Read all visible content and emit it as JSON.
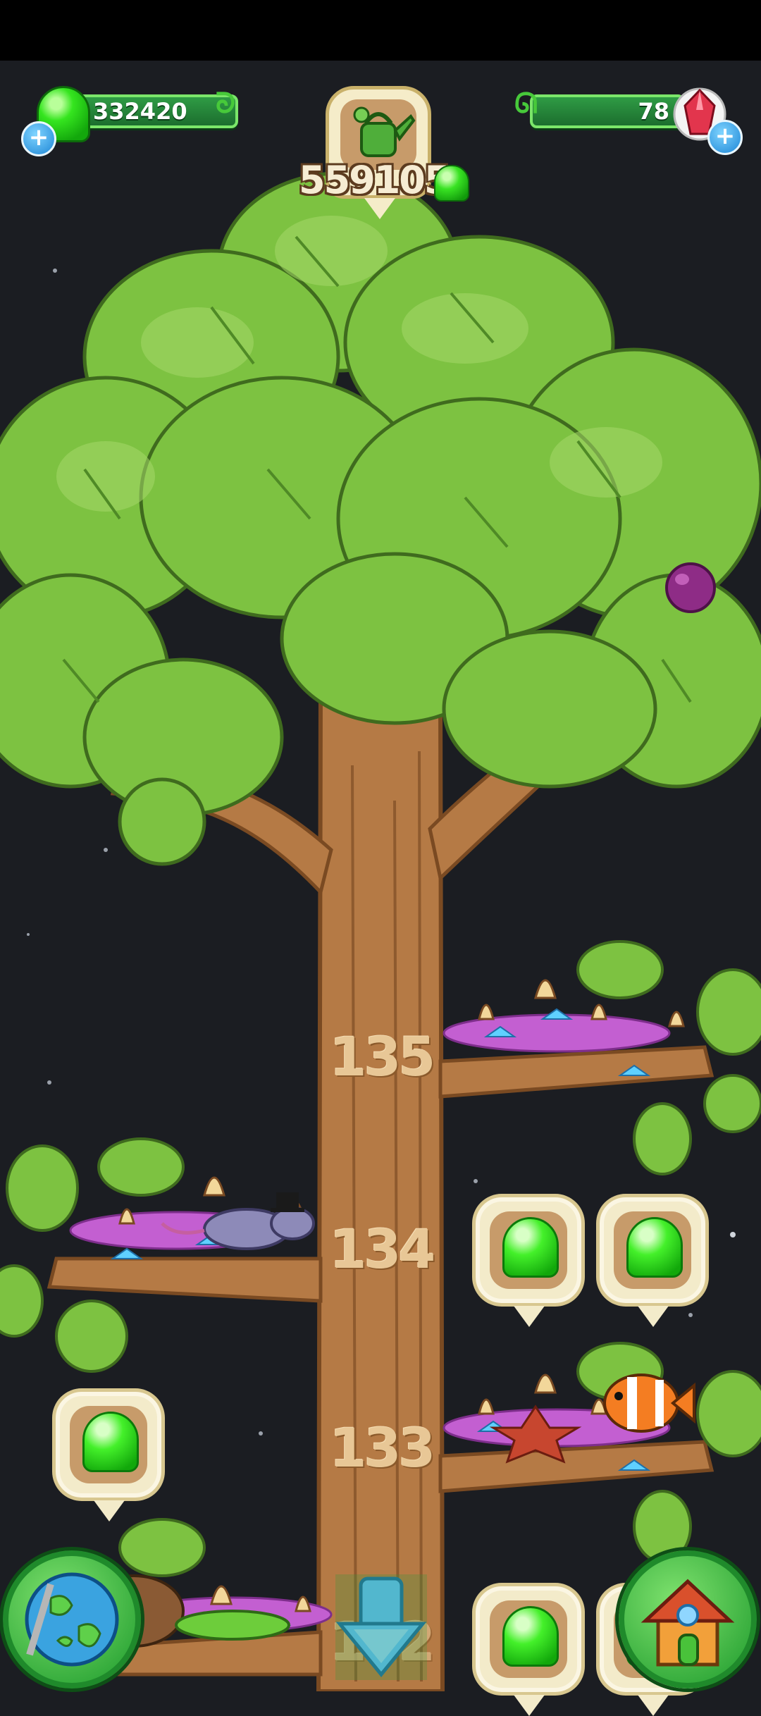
{
  "hud": {
    "gum_count": "332420",
    "gem_count": "78",
    "watering_can_count": "559105",
    "gum_icon": "green-gum-icon",
    "gem_icon": "red-gem-icon",
    "add_icon": "plus-icon"
  },
  "tree": {
    "levels": [
      {
        "number": "135"
      },
      {
        "number": "134"
      },
      {
        "number": "133"
      },
      {
        "number": "132"
      }
    ]
  },
  "buttons": {
    "world_icon": "globe-icon",
    "home_icon": "house-icon",
    "scroll_icon": "arrow-down-icon"
  },
  "colors": {
    "leaf": "#7dc241",
    "trunk": "#b57a45",
    "gum": "#3ddc23",
    "background": "#1b1d22"
  }
}
